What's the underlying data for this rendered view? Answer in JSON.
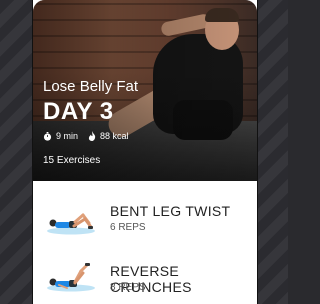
{
  "workout": {
    "title": "Lose Belly Fat",
    "day": "DAY 3",
    "duration": "9 min",
    "calories": "88 kcal",
    "exercise_count": "15 Exercises"
  },
  "exercises": [
    {
      "name": "BENT LEG TWIST",
      "reps": "6 REPS"
    },
    {
      "name": "REVERSE CRUNCHES",
      "reps": "8 REPS"
    }
  ],
  "icons": [
    "timer-icon",
    "flame-icon"
  ],
  "colors": {
    "accent": "#1ea0ff",
    "mat": "#bfe3f5"
  }
}
